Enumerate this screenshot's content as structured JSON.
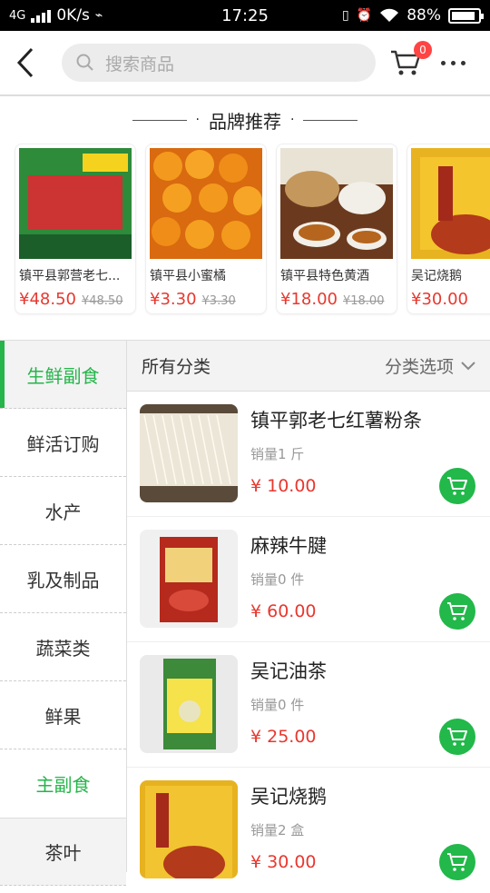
{
  "status": {
    "network": "4G",
    "speed": "0K/s",
    "time": "17:25",
    "battery": "88%",
    "battery_level": 0.88
  },
  "header": {
    "search_placeholder": "搜索商品",
    "cart_count": "0"
  },
  "brand": {
    "title": "品牌推荐",
    "items": [
      {
        "name": "镇平县郭营老七...",
        "price": "¥48.50",
        "old_price": "¥48.50"
      },
      {
        "name": "镇平县小蜜橘",
        "price": "¥3.30",
        "old_price": "¥3.30"
      },
      {
        "name": "镇平县特色黄酒",
        "price": "¥18.00",
        "old_price": "¥18.00"
      },
      {
        "name": "吴记烧鹅",
        "price": "¥30.00",
        "old_price": ""
      }
    ]
  },
  "sidebar": {
    "items": [
      {
        "label": "生鲜副食"
      },
      {
        "label": "鲜活订购"
      },
      {
        "label": "水产"
      },
      {
        "label": "乳及制品"
      },
      {
        "label": "蔬菜类"
      },
      {
        "label": "鲜果"
      },
      {
        "label": "主副食"
      },
      {
        "label": "茶叶"
      }
    ]
  },
  "content": {
    "all_label": "所有分类",
    "options_label": "分类选项",
    "products": [
      {
        "name": "镇平郭老七红薯粉条",
        "sales": "销量1 斤",
        "price": "¥ 10.00"
      },
      {
        "name": "麻辣牛腱",
        "sales": "销量0 件",
        "price": "¥ 60.00"
      },
      {
        "name": "吴记油茶",
        "sales": "销量0 件",
        "price": "¥ 25.00"
      },
      {
        "name": "吴记烧鹅",
        "sales": "销量2 盒",
        "price": "¥ 30.00"
      }
    ]
  },
  "colors": {
    "accent": "#25b54a",
    "price": "#e8382f",
    "badge": "#ff4444"
  }
}
